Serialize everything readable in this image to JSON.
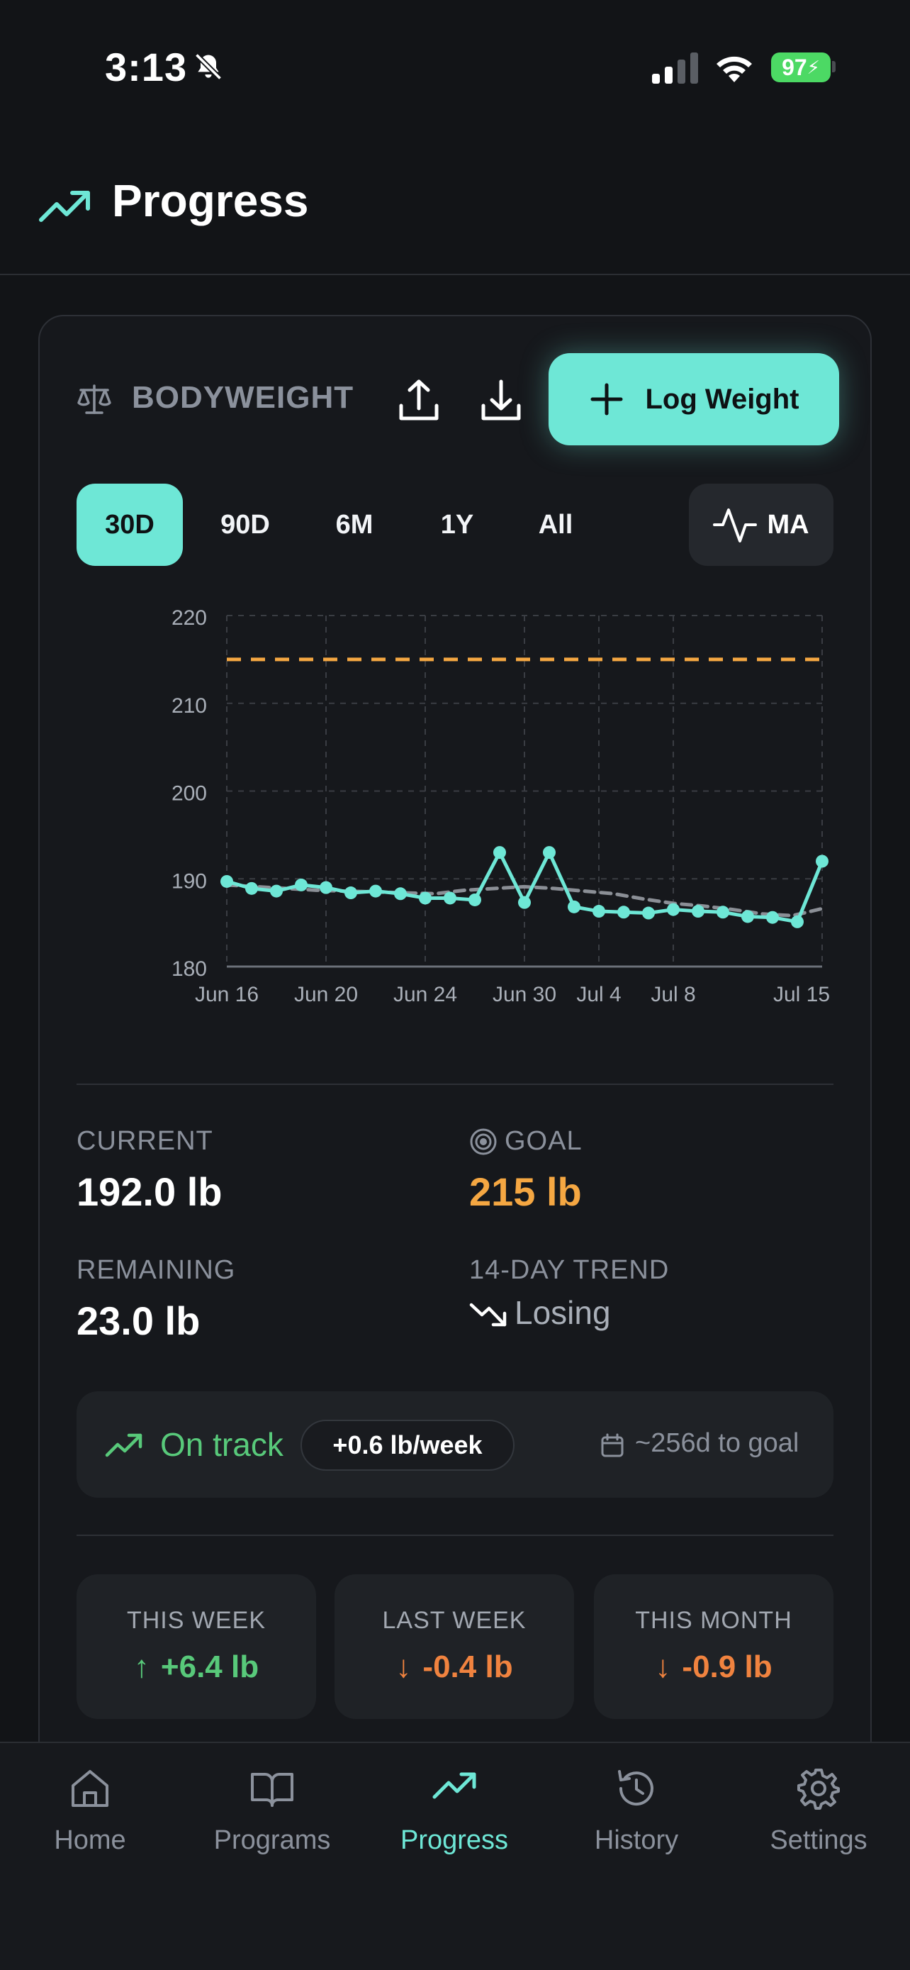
{
  "status": {
    "time": "3:13",
    "battery": "97"
  },
  "header": {
    "title": "Progress"
  },
  "card": {
    "section_label": "BODYWEIGHT",
    "log_button": "Log Weight",
    "ranges": [
      "30D",
      "90D",
      "6M",
      "1Y",
      "All"
    ],
    "active_range": "30D",
    "ma_label": "MA"
  },
  "chart_data": {
    "type": "line",
    "ylim": [
      180,
      220
    ],
    "yticks": [
      "220",
      "210",
      "200",
      "190",
      "180"
    ],
    "xtick_labels": [
      "Jun 16",
      "Jun 20",
      "Jun 24",
      "Jun 30",
      "Jul 4",
      "Jul 8",
      "Jul 15"
    ],
    "goal_line": 215,
    "series": [
      {
        "values": [
          189.7,
          188.9,
          188.6,
          189.3,
          189.0,
          188.4,
          188.6,
          188.3,
          187.8,
          187.8,
          187.6,
          193.0,
          187.3,
          193.0,
          186.8,
          186.3,
          186.2,
          186.1,
          186.5,
          186.3,
          186.2,
          185.7,
          185.6,
          185.1,
          192.0
        ]
      },
      {
        "values": [
          189.3,
          189.1,
          188.9,
          188.7,
          188.6,
          188.5,
          188.4,
          188.3,
          188.7,
          188.9,
          189.1,
          188.9,
          188.6,
          188.3,
          187.7,
          187.2,
          186.9,
          186.5,
          186.0,
          185.8,
          186.6
        ]
      }
    ],
    "grid": true
  },
  "stats": {
    "current_label": "CURRENT",
    "current_value": "192.0 lb",
    "goal_label": "GOAL",
    "goal_value": "215 lb",
    "remaining_label": "REMAINING",
    "remaining_value": "23.0 lb",
    "trend_label": "14-DAY TREND",
    "trend_value": "Losing"
  },
  "track": {
    "status": "On track",
    "rate": "+0.6 lb/week",
    "eta": "~256d to goal"
  },
  "periods": [
    {
      "label": "THIS WEEK",
      "arrow": "↑",
      "value": "+6.4 lb"
    },
    {
      "label": "LAST WEEK",
      "arrow": "↓",
      "value": "-0.4 lb"
    },
    {
      "label": "THIS MONTH",
      "arrow": "↓",
      "value": "-0.9 lb"
    }
  ],
  "colors": {
    "accent": "#6ee7d6",
    "goal": "#f5a742",
    "positive": "#58c97a",
    "negative": "#f0833f"
  },
  "tabs": [
    {
      "label": "Home",
      "icon": "home-icon"
    },
    {
      "label": "Programs",
      "icon": "book-icon"
    },
    {
      "label": "Progress",
      "icon": "trending-up-icon"
    },
    {
      "label": "History",
      "icon": "history-icon"
    },
    {
      "label": "Settings",
      "icon": "gear-icon"
    }
  ],
  "active_tab": "Progress"
}
